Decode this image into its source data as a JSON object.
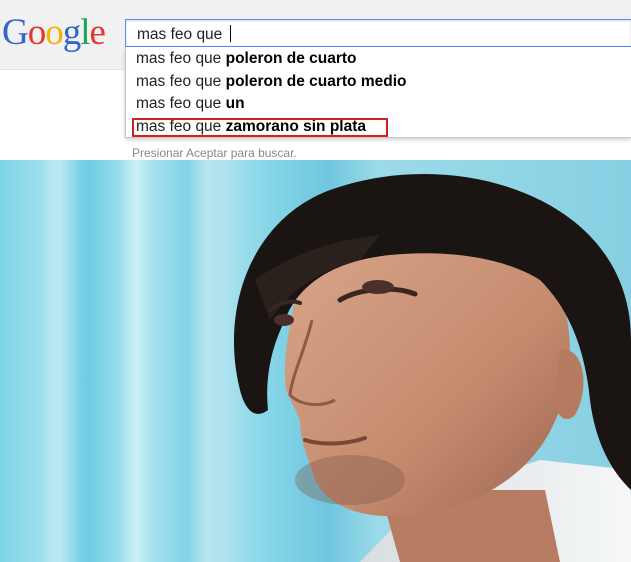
{
  "logo": {
    "text": "Google"
  },
  "search": {
    "query": "mas feo que "
  },
  "suggestions": [
    {
      "prefix": "mas feo que ",
      "completion": "poleron de cuarto"
    },
    {
      "prefix": "mas feo que ",
      "completion": "poleron de cuarto medio"
    },
    {
      "prefix": "mas feo que ",
      "completion": "un"
    },
    {
      "prefix": "mas feo que ",
      "completion": "zamorano sin plata",
      "highlighted": true
    }
  ],
  "hint": "Presionar Aceptar para buscar.",
  "colors": {
    "highlight_border": "#d21f1f",
    "search_border": "#4d90fe",
    "header_bg": "#f1f1f1",
    "photo_bg": "#7ed3e6"
  },
  "photo": {
    "subject": "man-portrait-photo"
  }
}
